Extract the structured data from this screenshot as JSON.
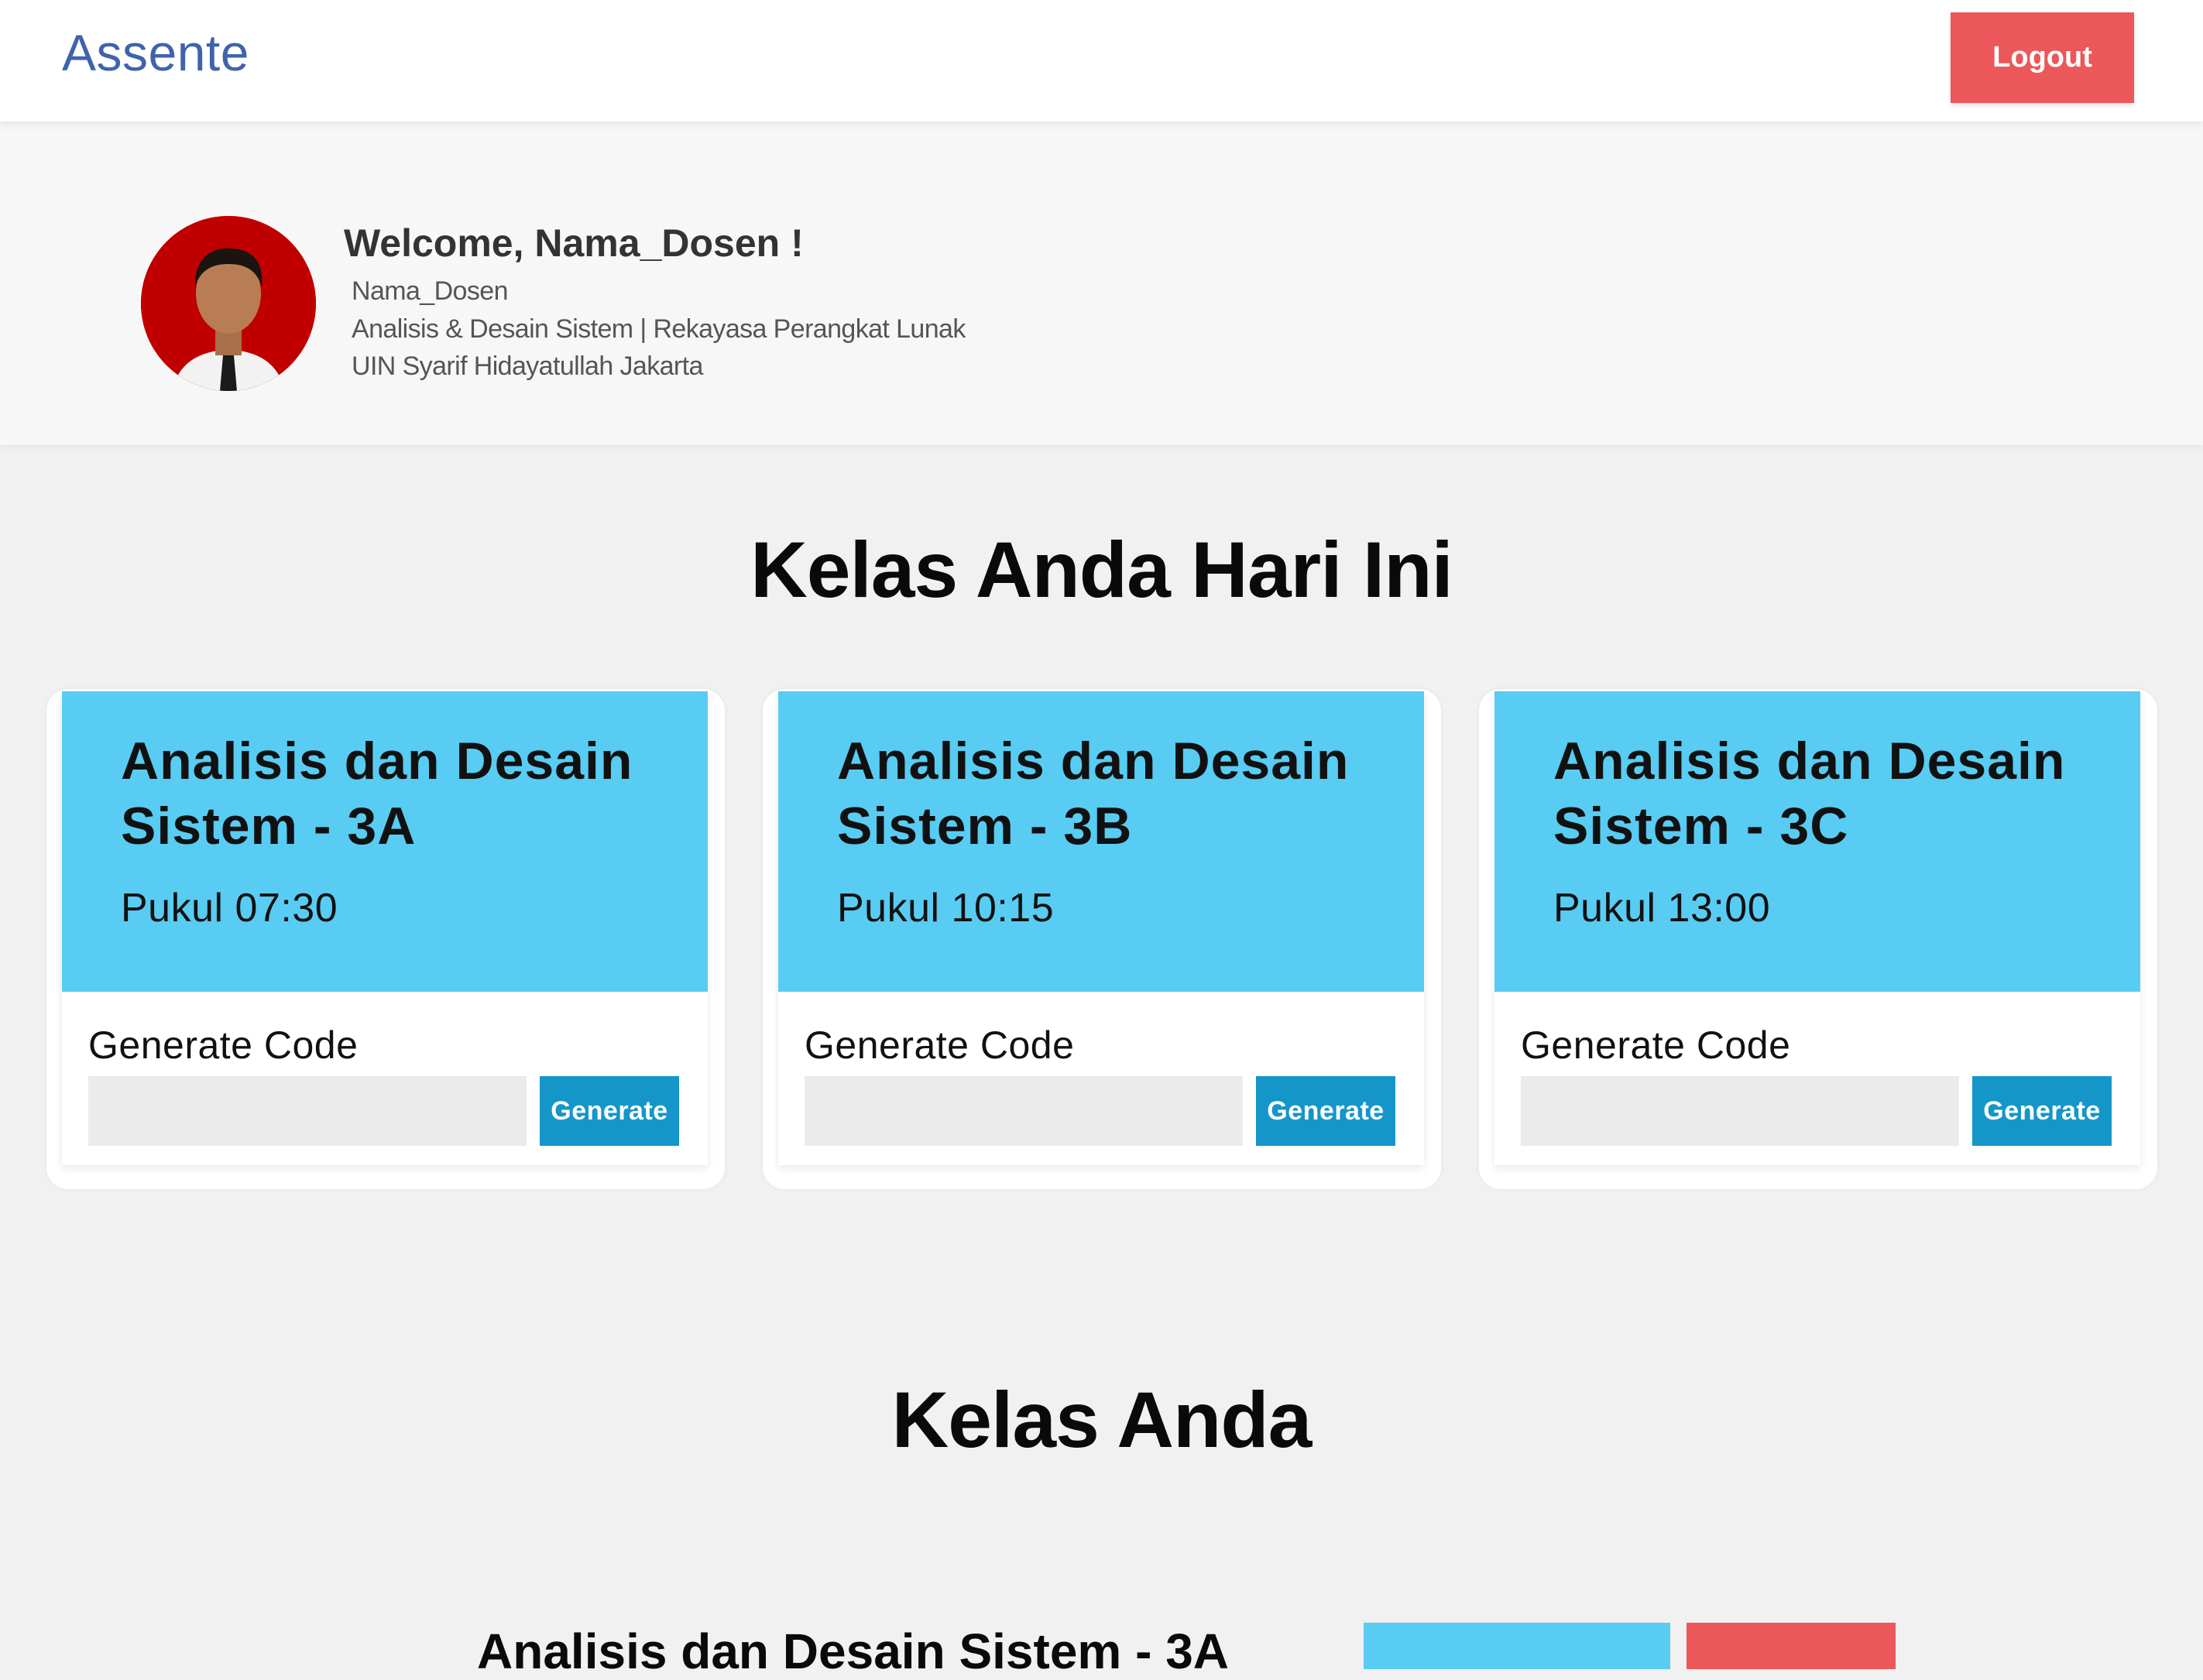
{
  "navbar": {
    "brand": "Assente",
    "logout_label": "Logout"
  },
  "profile": {
    "welcome": "Welcome, Nama_Dosen !",
    "name": "Nama_Dosen",
    "courses": "Analisis & Desain Sistem | Rekayasa Perangkat Lunak",
    "university": "UIN Syarif Hidayatullah Jakarta"
  },
  "today": {
    "title": "Kelas Anda Hari Ini",
    "cards": [
      {
        "title": "Analisis dan Desain Sistem - 3A",
        "time": "Pukul 07:30",
        "generate_label": "Generate Code",
        "button_label": "Generate"
      },
      {
        "title": "Analisis dan Desain Sistem - 3B",
        "time": "Pukul 10:15",
        "generate_label": "Generate Code",
        "button_label": "Generate"
      },
      {
        "title": "Analisis dan Desain Sistem - 3C",
        "time": "Pukul 13:00",
        "generate_label": "Generate Code",
        "button_label": "Generate"
      }
    ]
  },
  "classes": {
    "title": "Kelas Anda",
    "first_item_title": "Analisis dan Desain Sistem - 3A"
  },
  "colors": {
    "brand": "#3f63ad",
    "danger": "#ec5759",
    "card_header": "#58ccf2",
    "primary": "#1596c8"
  }
}
